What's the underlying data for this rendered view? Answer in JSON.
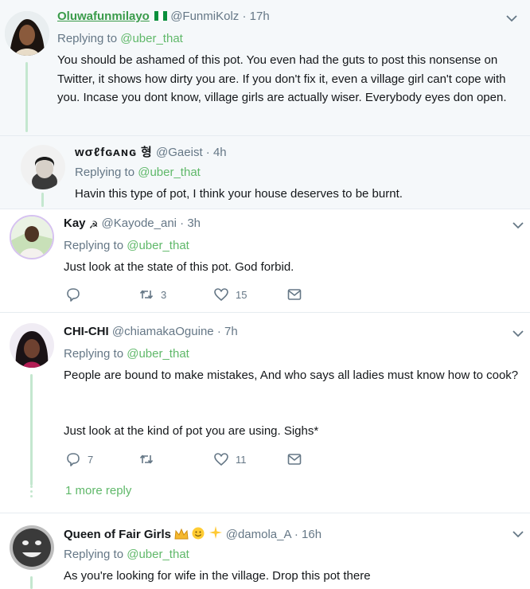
{
  "reply_target": "@uber_that",
  "replying_label": "Replying to ",
  "tweets": [
    {
      "name": "Oluwafunmilayo",
      "handle": "@FunmiKolz",
      "time": "17h",
      "text": "You should be ashamed of this pot. You even had the guts to post this nonsense on Twitter, it shows how dirty you are. If you don't fix it, even a village girl can't cope with you. Incase you dont know, village girls are actually wiser. Everybody eyes don open."
    },
    {
      "name": "ᴡσℓfɢᴀɴɢ 형",
      "handle": "@Gaeist",
      "time": "4h",
      "text": "Havin this type of pot, I think your house deserves to be burnt."
    },
    {
      "name": "Kay",
      "handle": "@Kayode_ani",
      "time": "3h",
      "text": "Just look at the state of this pot. God forbid.",
      "retweets": "3",
      "likes": "15",
      "replies": ""
    },
    {
      "name": "CHI-CHI",
      "handle": "@chiamakaOguine",
      "time": "7h",
      "text_line1": "People are bound to make mistakes, And who says all ladies must know how to cook?",
      "text_line2": "Just look at the kind of pot you are using.  Sighs*",
      "replies": "7",
      "retweets": "",
      "likes": "11"
    },
    {
      "name": "Queen of Fair Girls",
      "handle": "@damola_A",
      "time": "16h",
      "text": "As you're looking for wife in the village. Drop this pot there"
    }
  ],
  "more_replies": "1 more reply",
  "colors": {
    "green": "#5fb869",
    "gray": "#657786",
    "thread": "#c4e7cf"
  },
  "icons": [
    "chevron-down-icon",
    "reply-icon",
    "retweet-icon",
    "heart-icon",
    "envelope-icon",
    "nigeria-flag-icon",
    "crown-icon",
    "smiley-icon",
    "sparkles-icon"
  ]
}
